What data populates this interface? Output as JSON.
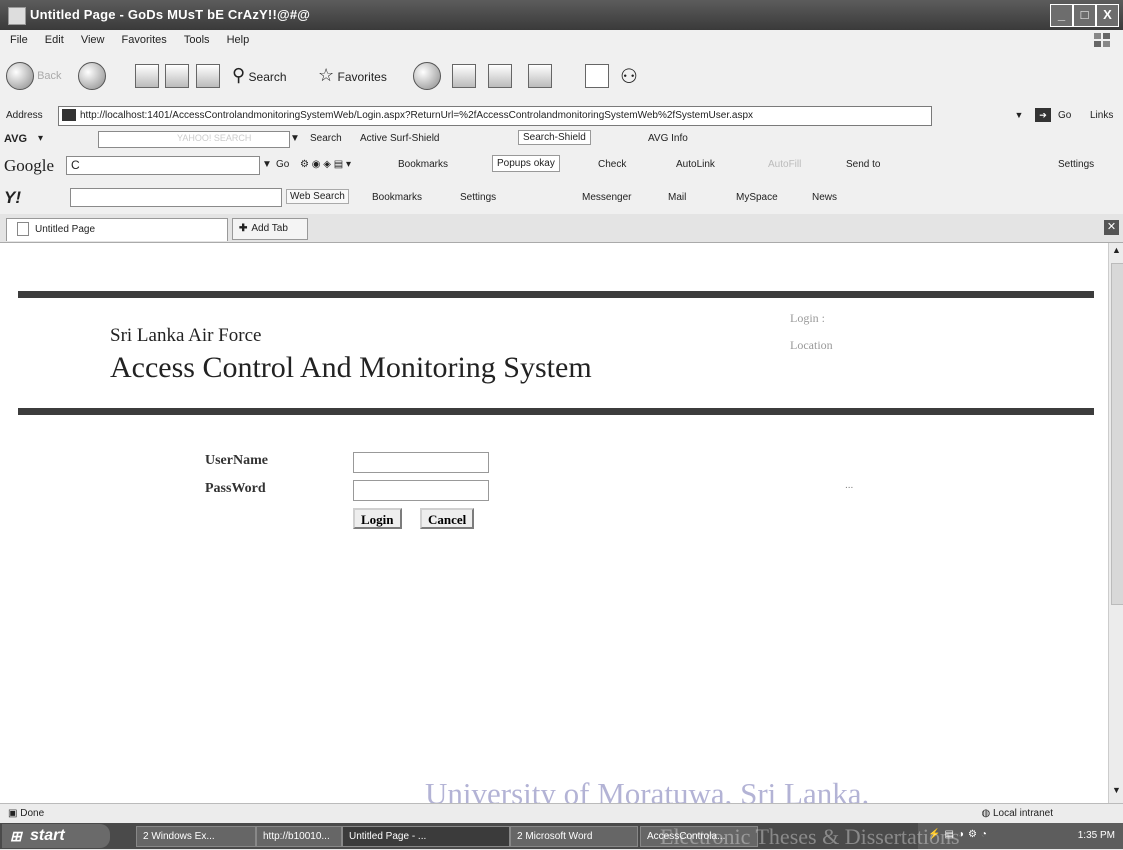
{
  "window": {
    "title": "Untitled Page - GoDs MUsT bE CrAzY!!@#@",
    "min": "_",
    "max": "□",
    "close": "X"
  },
  "menubar": [
    "File",
    "Edit",
    "View",
    "Favorites",
    "Tools",
    "Help"
  ],
  "toolbar": {
    "back": "Back",
    "search": "Search",
    "favorites": "Favorites"
  },
  "address": {
    "label": "Address",
    "url": "http://localhost:1401/AccessControlandmonitoringSystemWeb/Login.aspx?ReturnUrl=%2fAccessControlandmonitoringSystemWeb%2fSystemUser.aspx",
    "go": "Go",
    "links": "Links"
  },
  "avgbar": {
    "logo": "AVG",
    "search_placeholder": "YAHOO! SEARCH",
    "search": "Search",
    "surf_shield": "Active Surf-Shield",
    "search_shield": "Search-Shield",
    "avg_info": "AVG Info"
  },
  "googlebar": {
    "logo": "Google",
    "query": "C",
    "go": "Go",
    "bookmarks": "Bookmarks",
    "popups": "Popups okay",
    "check": "Check",
    "autolink": "AutoLink",
    "autofill": "AutoFill",
    "sendto": "Send to",
    "settings": "Settings"
  },
  "yahoobar": {
    "logo": "Y!",
    "web_search": "Web Search",
    "bookmarks": "Bookmarks",
    "settings": "Settings",
    "messenger": "Messenger",
    "mail": "Mail",
    "myspace": "MySpace",
    "news": "News"
  },
  "tabs": {
    "active": "Untitled Page",
    "add": "Add Tab"
  },
  "page": {
    "org": "Sri Lanka Air Force",
    "system": "Access Control And Monitoring System",
    "login_label": "Login  :",
    "location_label": "Location",
    "username_label": "UserName",
    "password_label": "PassWord",
    "username_value": "",
    "password_value": "",
    "login_btn": "Login",
    "cancel_btn": "Cancel",
    "dots": "..."
  },
  "status": {
    "done": "Done",
    "zone": "Local intranet",
    "watermark": "University of Moratuwa, Sri Lanka."
  },
  "taskbar": {
    "start": "start",
    "tasks": [
      "2 Windows Ex...",
      "http://b10010...",
      "Untitled Page - ...",
      "2 Microsoft Word",
      "AccessControla..."
    ],
    "clock": "1:35 PM",
    "watermark": "Electronic Theses & Dissertations"
  },
  "colors": {
    "titlebar": "#4a4a4a",
    "rule": "#3c3c3c",
    "watermark": "#9a9ac8"
  }
}
